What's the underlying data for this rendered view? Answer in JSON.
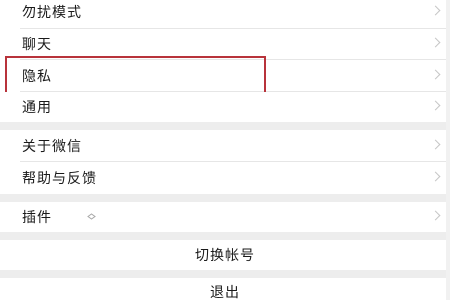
{
  "settings": {
    "items": [
      {
        "label": "勿扰模式"
      },
      {
        "label": "聊天"
      },
      {
        "label": "隐私"
      },
      {
        "label": "通用"
      },
      {
        "label": "关于微信"
      },
      {
        "label": "帮助与反馈"
      },
      {
        "label": "插件"
      }
    ],
    "switch_account_label": "切换帐号",
    "logout_label": "退出"
  },
  "colors": {
    "highlight_border": "#b8333b",
    "section_gap": "#ededed",
    "chevron": "#c6c6c6"
  }
}
